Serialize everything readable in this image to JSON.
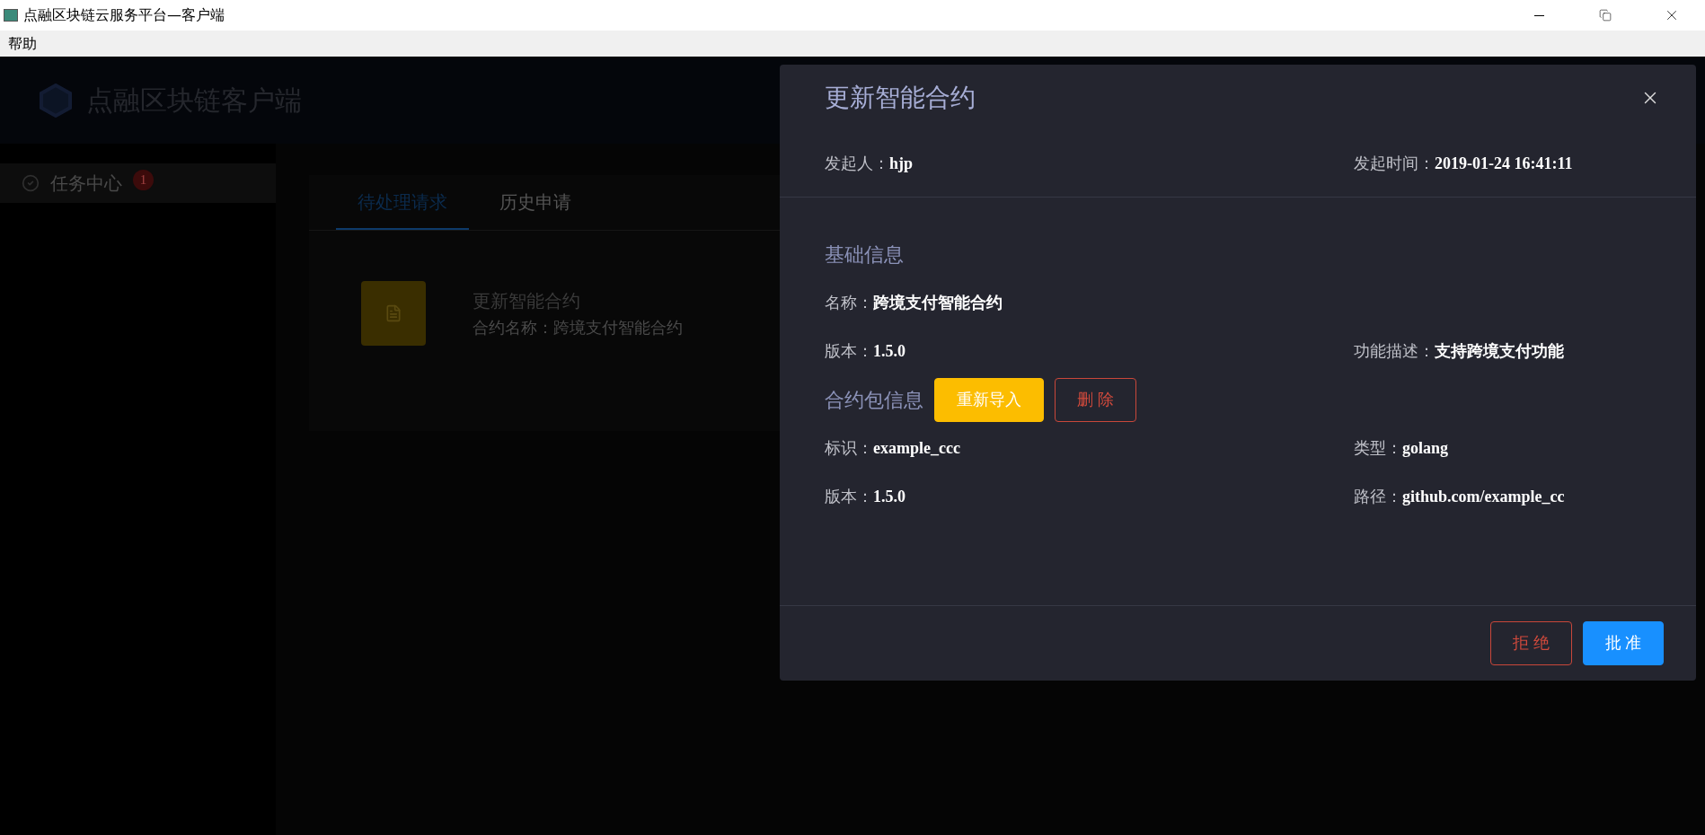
{
  "window": {
    "title": "点融区块链云服务平台—客户端",
    "menu": [
      "帮助"
    ]
  },
  "app": {
    "logo_text": "点融区块链客户端",
    "sidebar": {
      "items": [
        {
          "label": "任务中心",
          "badge": "1",
          "selected": true
        }
      ]
    },
    "tabs": [
      {
        "label": "待处理请求",
        "selected": true
      },
      {
        "label": "历史申请",
        "selected": false
      }
    ],
    "tasks": [
      {
        "title": "更新智能合约",
        "subtitle": "合约名称：跨境支付智能合约"
      }
    ]
  },
  "dialog": {
    "title": "更新智能合约",
    "meta": [
      {
        "label": "发起人：",
        "value": "hjp"
      },
      {
        "label": "发起时间：",
        "value": "2019-01-24 16:41:11"
      }
    ],
    "sections": [
      {
        "title": "基础信息",
        "rows": [
          [
            {
              "label": "名称：",
              "value": "跨境支付智能合约"
            }
          ],
          [
            {
              "label": "版本：",
              "value": "1.5.0"
            },
            {
              "label": "功能描述：",
              "value": "支持跨境支付功能"
            }
          ]
        ]
      },
      {
        "title": "合约包信息",
        "actions": [
          {
            "label": "重新导入",
            "kind": "warning"
          },
          {
            "label": "删 除",
            "kind": "danger"
          }
        ],
        "rows": [
          [
            {
              "label": "标识：",
              "value": "example_ccc"
            },
            {
              "label": "类型：",
              "value": "golang"
            }
          ],
          [
            {
              "label": "版本：",
              "value": "1.5.0"
            },
            {
              "label": "路径：",
              "value": "github.com/example_cc"
            }
          ]
        ]
      }
    ],
    "footer_buttons": [
      {
        "label": "拒 绝",
        "kind": "danger"
      },
      {
        "label": "批 准",
        "kind": "primary"
      }
    ]
  }
}
